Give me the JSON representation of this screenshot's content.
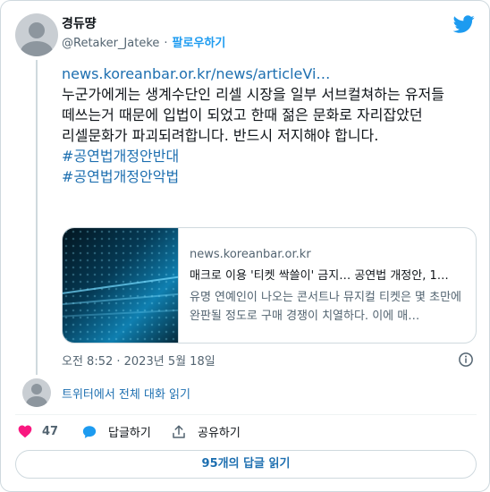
{
  "author": {
    "name": "경듀땽",
    "handle": "@Retaker_Jateke",
    "separator": "·",
    "follow_label": "팔로우하기"
  },
  "tweet": {
    "link": "news.koreanbar.or.kr/news/articleVi…",
    "text": "누군가에게는 생계수단인 리셀 시장을 일부 서브컬쳐하는 유저들 떼쓰는거 때문에 입법이 되었고 한때 젊은 문화로 자리잡았던 리셀문화가 파괴되려합니다. 반드시 저지해야 합니다.",
    "hashtags": [
      "#공연법개정안반대",
      "#공연법개정안악법"
    ]
  },
  "link_card": {
    "domain": "news.koreanbar.or.kr",
    "title": "매크로 이용 '티켓 싹쓸이' 금지… 공연법 개정안, 1…",
    "description": "유명 연예인이 나오는 콘서트나 뮤지컬 티켓은 몇 초만에 완판될 정도로 구매 경쟁이 치열하다. 이에 매…"
  },
  "meta": {
    "timestamp": "오전 8:52 · 2023년 5월 18일",
    "read_conversation": "트위터에서 전체 대화 읽기"
  },
  "actions": {
    "likes": "47",
    "reply_label": "답글하기",
    "share_label": "공유하기"
  },
  "replies_button": "95개의 답글 읽기",
  "icons": {
    "brand": "twitter-bird-icon",
    "like": "heart-icon",
    "reply": "reply-bubble-icon",
    "share": "share-icon",
    "info": "info-icon"
  },
  "colors": {
    "accent": "#1d9bf0",
    "link": "#1d6fb0",
    "like": "#f91880",
    "muted": "#536471",
    "border": "#cfd9de"
  }
}
